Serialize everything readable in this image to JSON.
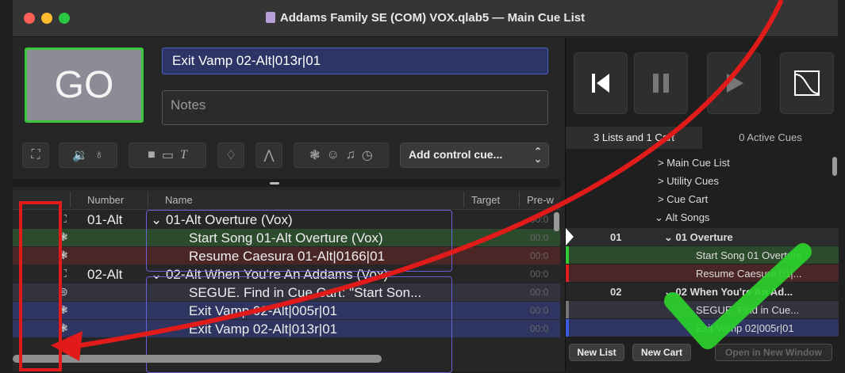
{
  "window": {
    "title": "Addams Family SE (COM) VOX.qlab5 — Main Cue List"
  },
  "go_button": {
    "label": "GO"
  },
  "cue_name_field": {
    "value": "Exit Vamp 02-Alt|013r|01"
  },
  "notes_field": {
    "placeholder": "Notes"
  },
  "toolbar": {
    "add_control_cue": "Add control cue..."
  },
  "table": {
    "headers": {
      "number": "Number",
      "name": "Name",
      "target": "Target",
      "prewait": "Pre-w"
    },
    "rows": [
      {
        "icon": "group-icon",
        "number": "01-Alt",
        "name": "⌄ 01-Alt Overture (Vox)",
        "pre": "00:0",
        "color": "#262626"
      },
      {
        "icon": "network-icon",
        "number": "",
        "name": "Start Song 01-Alt Overture (Vox)",
        "pre": "00:0",
        "color": "#2c4a2c"
      },
      {
        "icon": "network-icon",
        "number": "",
        "name": "Resume Caesura 01-Alt|0166|01",
        "pre": "00:0",
        "color": "#4a2627"
      },
      {
        "icon": "group-icon",
        "number": "02-Alt",
        "name": "⌄ 02-Alt When You're An Addams (Vox)",
        "pre": "00:0",
        "color": "#262626"
      },
      {
        "icon": "memo-icon",
        "number": "",
        "name": "SEGUE. Find in Cue Cart: \"Start Son...",
        "pre": "00:0",
        "color": "#333340"
      },
      {
        "icon": "network-icon",
        "number": "",
        "name": "Exit Vamp 02-Alt|005r|01",
        "pre": "00:0",
        "color": "#2d3560"
      },
      {
        "icon": "network-icon",
        "number": "",
        "name": "Exit Vamp 02-Alt|013r|01",
        "pre": "00:0",
        "color": "#2d3560"
      }
    ]
  },
  "right_pane": {
    "tabs": {
      "lists": "3 Lists and 1 Cart",
      "active": "0 Active Cues"
    },
    "lists": [
      {
        "label": "> Main Cue List"
      },
      {
        "label": "> Utility Cues"
      },
      {
        "label": "> Cue Cart"
      },
      {
        "label": "⌄ Alt Songs"
      }
    ],
    "cues": [
      {
        "number": "01",
        "name": "⌄ 01 Overture",
        "color": "#2c2c2c",
        "marker": ""
      },
      {
        "number": "",
        "name": "Start Song 01 Overture",
        "color": "#2c4a2c",
        "marker": "#2ecc2e"
      },
      {
        "number": "",
        "name": "Resume Caesura 01|...",
        "color": "#4a2627",
        "marker": "#e02020"
      },
      {
        "number": "02",
        "name": "⌄ 02 When You're An Ad...",
        "color": "#262626",
        "marker": ""
      },
      {
        "number": "",
        "name": "SEGUE. Find in Cue...",
        "color": "#333340",
        "marker": "#777"
      },
      {
        "number": "",
        "name": "Exit Vamp 02|005r|01",
        "color": "#2d3560",
        "marker": "#3a5bdc"
      }
    ],
    "buttons": {
      "new_list": "New List",
      "new_cart": "New Cart",
      "open_window": "Open in New Window"
    }
  },
  "colors": {
    "go_border": "#3cc83c",
    "annotation_red": "#e11a1a",
    "annotation_green": "#2bd12b",
    "selection_blue": "#2c3566"
  }
}
